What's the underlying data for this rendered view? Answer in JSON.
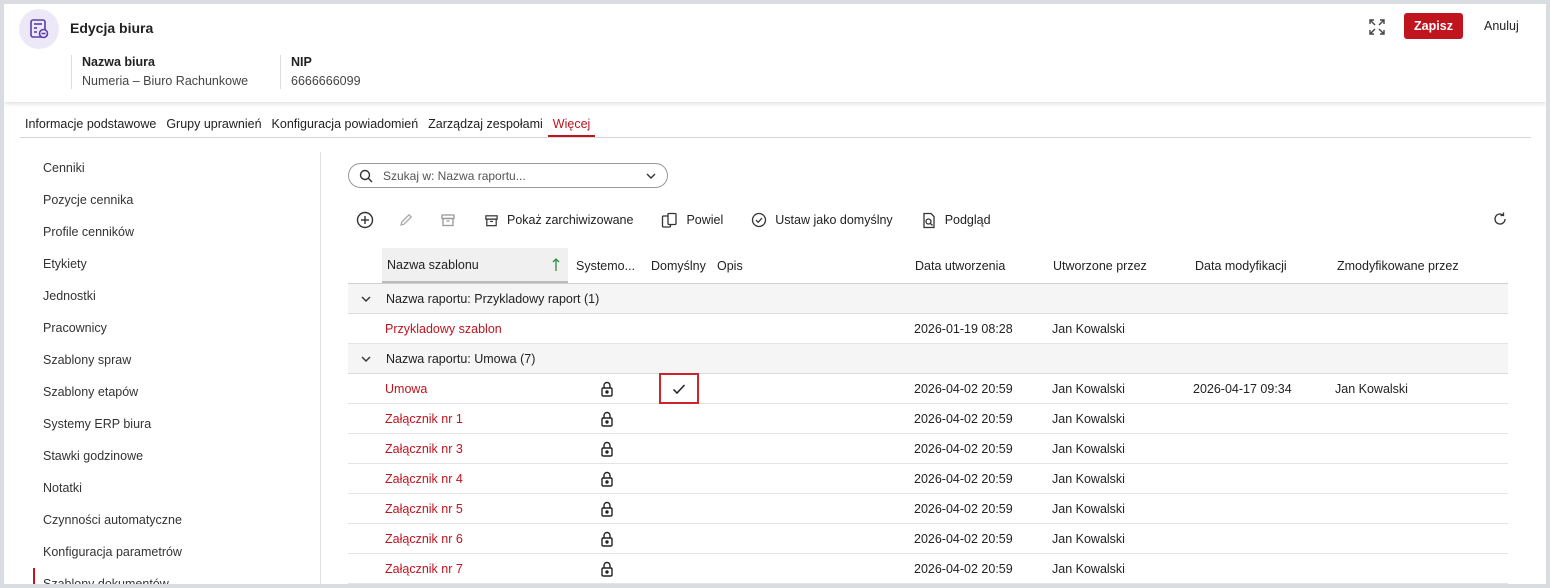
{
  "header": {
    "title": "Edycja biura",
    "office_name_label": "Nazwa biura",
    "office_name_value": "Numeria – Biuro Rachunkowe",
    "nip_label": "NIP",
    "nip_value": "6666666099",
    "save_label": "Zapisz",
    "cancel_label": "Anuluj"
  },
  "tabs": [
    {
      "label": "Informacje podstawowe",
      "active": false
    },
    {
      "label": "Grupy uprawnień",
      "active": false
    },
    {
      "label": "Konfiguracja powiadomień",
      "active": false
    },
    {
      "label": "Zarządzaj zespołami",
      "active": false
    },
    {
      "label": "Więcej",
      "active": true
    }
  ],
  "sidebar": {
    "items": [
      {
        "label": "Cenniki"
      },
      {
        "label": "Pozycje cennika"
      },
      {
        "label": "Profile cenników"
      },
      {
        "label": "Etykiety"
      },
      {
        "label": "Jednostki"
      },
      {
        "label": "Pracownicy"
      },
      {
        "label": "Szablony spraw"
      },
      {
        "label": "Szablony etapów"
      },
      {
        "label": "Systemy ERP biura"
      },
      {
        "label": "Stawki godzinowe"
      },
      {
        "label": "Notatki"
      },
      {
        "label": "Czynności automatyczne"
      },
      {
        "label": "Konfiguracja parametrów"
      },
      {
        "label": "Szablony dokumentów"
      }
    ]
  },
  "search": {
    "placeholder": "Szukaj w: Nazwa raportu..."
  },
  "toolbar": {
    "show_archived": "Pokaż zarchiwizowane",
    "duplicate": "Powiel",
    "set_default": "Ustaw jako domyślny",
    "preview": "Podgląd"
  },
  "table": {
    "columns": [
      "Nazwa szablonu",
      "Systemo...",
      "Domyślny",
      "Opis",
      "Data utworzenia",
      "Utworzone przez",
      "Data modyfikacji",
      "Zmodyfikowane przez"
    ],
    "groups": [
      {
        "label": "Nazwa raportu: Przykladowy raport (1)",
        "rows": [
          {
            "name": "Przykladowy szablon",
            "system": false,
            "default": false,
            "created": "2026-01-19 08:28",
            "created_by": "Jan Kowalski",
            "modified": "",
            "modified_by": ""
          }
        ]
      },
      {
        "label": "Nazwa raportu: Umowa (7)",
        "rows": [
          {
            "name": "Umowa",
            "system": true,
            "default": true,
            "created": "2026-04-02 20:59",
            "created_by": "Jan Kowalski",
            "modified": "2026-04-17 09:34",
            "modified_by": "Jan Kowalski"
          },
          {
            "name": "Załącznik nr 1",
            "system": true,
            "default": false,
            "created": "2026-04-02 20:59",
            "created_by": "Jan Kowalski",
            "modified": "",
            "modified_by": ""
          },
          {
            "name": "Załącznik nr 3",
            "system": true,
            "default": false,
            "created": "2026-04-02 20:59",
            "created_by": "Jan Kowalski",
            "modified": "",
            "modified_by": ""
          },
          {
            "name": "Załącznik nr 4",
            "system": true,
            "default": false,
            "created": "2026-04-02 20:59",
            "created_by": "Jan Kowalski",
            "modified": "",
            "modified_by": ""
          },
          {
            "name": "Załącznik nr 5",
            "system": true,
            "default": false,
            "created": "2026-04-02 20:59",
            "created_by": "Jan Kowalski",
            "modified": "",
            "modified_by": ""
          },
          {
            "name": "Załącznik nr 6",
            "system": true,
            "default": false,
            "created": "2026-04-02 20:59",
            "created_by": "Jan Kowalski",
            "modified": "",
            "modified_by": ""
          },
          {
            "name": "Załącznik nr 7",
            "system": true,
            "default": false,
            "created": "2026-04-02 20:59",
            "created_by": "Jan Kowalski",
            "modified": "",
            "modified_by": ""
          }
        ]
      }
    ]
  },
  "colors": {
    "accent": "#c0141f",
    "icon_bg": "#ede8f7",
    "icon_fg": "#5b3fa8"
  },
  "icons": [
    "office-icon",
    "expand-icon",
    "search-icon",
    "chevron-down-icon",
    "add-icon",
    "edit-icon",
    "archive-icon",
    "show-archived-icon",
    "duplicate-icon",
    "set-default-icon",
    "preview-icon",
    "refresh-icon",
    "sort-ascending-icon",
    "collapse-icon",
    "lock-icon",
    "check-icon"
  ]
}
